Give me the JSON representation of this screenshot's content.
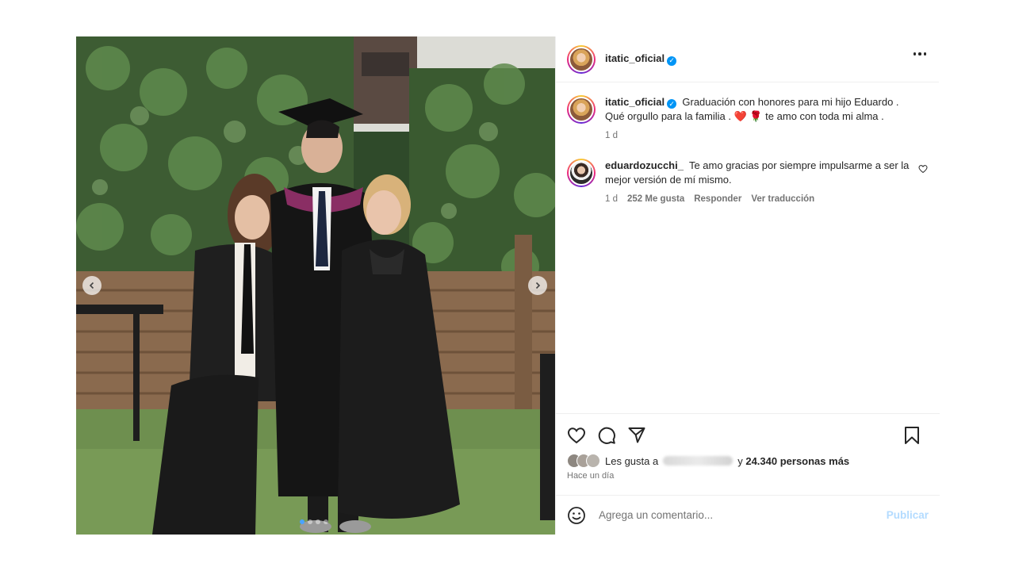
{
  "post": {
    "slide_count": 4,
    "active_slide": 1,
    "author": {
      "username": "itatic_oficial",
      "verified": true
    }
  },
  "caption": {
    "username": "itatic_oficial",
    "text": "Graduación con honores para mi hijo Eduardo . Qué orgullo para la familia . ❤️ 🌹 te amo con toda mi alma .",
    "time": "1 d"
  },
  "comments": [
    {
      "username": "eduardozucchi_",
      "text": "Te amo gracias por siempre impulsarme a ser la mejor versión de mí mismo.",
      "time": "1 d",
      "likes": "252 Me gusta",
      "reply": "Responder",
      "translate": "Ver traducción"
    }
  ],
  "likes": {
    "prefix": "Les gusta a",
    "connector": "y",
    "count_text": "24.340 personas más"
  },
  "posted": "Hace un día",
  "comment_input": {
    "placeholder": "Agrega un comentario...",
    "value": ""
  },
  "publish_label": "Publicar",
  "colors": {
    "verified": "#0095f6",
    "publish_disabled": "#b3dbff",
    "secondary_text": "#737373",
    "active_dot": "#4aa3ff"
  }
}
